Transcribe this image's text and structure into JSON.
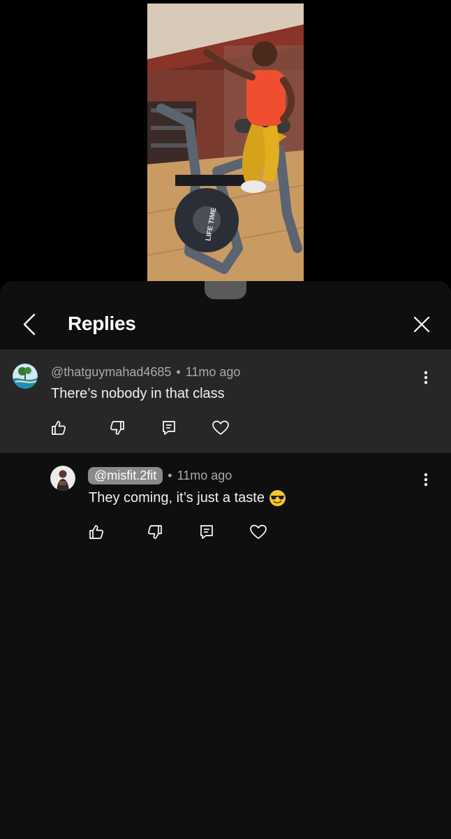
{
  "header": {
    "title": "Replies"
  },
  "comments": [
    {
      "author": "@thatguymahad4685",
      "time": "11mo ago",
      "text": "There’s nobody in that class"
    },
    {
      "author": "@misfit.2fit",
      "time": "11mo ago",
      "text": "They coming, it’s just a taste",
      "emoji": "smiling-face-with-sunglasses"
    }
  ],
  "video": {
    "brand_text": "LIFE TIME"
  }
}
